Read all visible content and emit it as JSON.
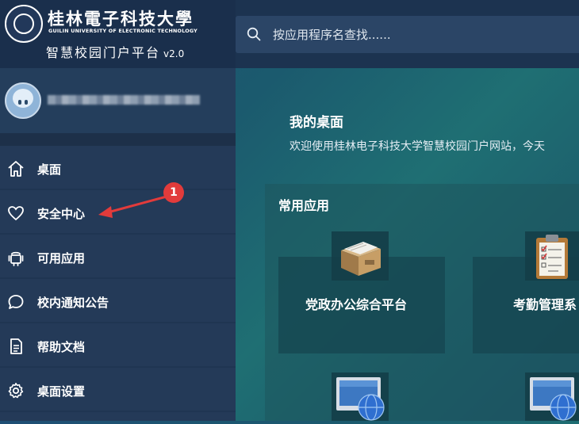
{
  "header": {
    "university_name": "桂林電子科技大學",
    "university_en": "GUILIN UNIVERSITY OF ELECTRONIC TECHNOLOGY",
    "portal_title": "智慧校园门户平台",
    "version": "v2.0"
  },
  "search": {
    "placeholder": "按应用程序名查找......"
  },
  "sidebar": {
    "items": [
      {
        "label": "桌面",
        "icon": "home-icon"
      },
      {
        "label": "安全中心",
        "icon": "heart-icon"
      },
      {
        "label": "可用应用",
        "icon": "android-icon"
      },
      {
        "label": "校内通知公告",
        "icon": "chat-bubble-icon"
      },
      {
        "label": "帮助文档",
        "icon": "document-icon"
      },
      {
        "label": "桌面设置",
        "icon": "gear-icon"
      }
    ]
  },
  "annotation": {
    "badge": "1",
    "color": "#e23b3b"
  },
  "main": {
    "welcome_title": "我的桌面",
    "welcome_text": "欢迎使用桂林电子科技大学智慧校园门户网站，今天",
    "apps_title": "常用应用",
    "apps": [
      {
        "label": "党政办公综合平台",
        "icon": "box-icon"
      },
      {
        "label": "考勤管理系",
        "icon": "clipboard-icon"
      },
      {
        "label": "",
        "icon": "monitor-globe-icon"
      },
      {
        "label": "",
        "icon": "monitor-globe-icon"
      }
    ]
  },
  "colors": {
    "header": "#1c3350",
    "sidebar": "#243a58",
    "accent": "#e23b3b"
  }
}
